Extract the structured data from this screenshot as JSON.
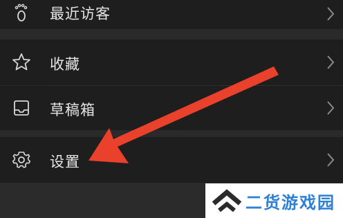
{
  "menu": {
    "items": [
      {
        "label": "最近访客",
        "icon": "footprint-icon"
      },
      {
        "label": "收藏",
        "icon": "star-icon"
      },
      {
        "label": "草稿箱",
        "icon": "inbox-tray-icon"
      },
      {
        "label": "设置",
        "icon": "gear-icon"
      }
    ]
  },
  "annotation": {
    "color": "#e9412b"
  },
  "watermark": {
    "text": "二货游戏园",
    "color": "#2e7fd6"
  }
}
